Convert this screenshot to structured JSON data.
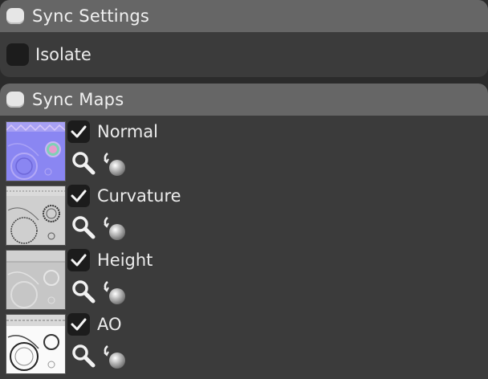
{
  "sync_settings": {
    "title": "Sync Settings",
    "isolate_label": "Isolate",
    "isolate_checked": false
  },
  "sync_maps": {
    "title": "Sync Maps",
    "maps": [
      {
        "label": "Normal",
        "checked": true,
        "thumbnail_icon": "normal-map-thumbnail"
      },
      {
        "label": "Curvature",
        "checked": true,
        "thumbnail_icon": "curvature-map-thumbnail"
      },
      {
        "label": "Height",
        "checked": true,
        "thumbnail_icon": "height-map-thumbnail"
      },
      {
        "label": "AO",
        "checked": true,
        "thumbnail_icon": "ao-map-thumbnail"
      }
    ]
  },
  "icons": {
    "search": "magnifier-icon",
    "preview_sphere": "preview-sphere-icon",
    "checkmark": "checkmark-icon"
  },
  "colors": {
    "header_bg": "#666666",
    "panel_bg": "#3b3b3b",
    "page_bg": "#2b2b2b",
    "checkbox_bg": "#1c1c1c",
    "text": "#ececec"
  }
}
